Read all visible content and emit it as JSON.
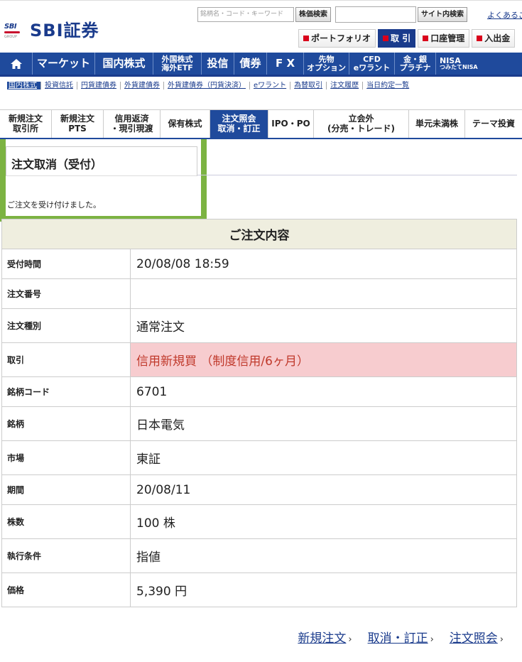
{
  "header": {
    "logo_small": "SBI",
    "logo_group": "GROUP",
    "logo_text": "SBI証券",
    "search_placeholder": "銘柄名・コード・キーワード",
    "stock_search_button": "株価検索",
    "site_search_button": "サイト内検索",
    "faq_link": "よくあるご",
    "topnav": [
      "ポートフォリオ",
      "取 引",
      "口座管理",
      "入出金"
    ]
  },
  "mainnav": {
    "items": [
      "マーケット",
      "国内株式",
      "外国株式",
      "海外ETF",
      "投信",
      "債券",
      "F X",
      "先物",
      "オプション",
      "CFD",
      "eワラント",
      "金・銀",
      "プラチナ",
      "NISA",
      "つみたてNISA"
    ]
  },
  "subnav": {
    "items": [
      "国内株式",
      "投資信託",
      "円貨建債券",
      "外貨建債券",
      "外貨建債券（円貨決済）",
      "eワラント",
      "為替取引",
      "注文履歴",
      "当日約定一覧"
    ]
  },
  "tabs": {
    "t1a": "新規注文",
    "t1b": "取引所",
    "t2a": "新規注文",
    "t2b": "PTS",
    "t3a": "信用返済",
    "t3b": "・現引現渡",
    "t4": "保有株式",
    "t5a": "注文照会",
    "t5b": "取消・訂正",
    "t6": "IPO・PO",
    "t7a": "立会外",
    "t7b": "(分売・トレード)",
    "t8": "単元未満株",
    "t9": "テーマ投資"
  },
  "page": {
    "title": "注文取消（受付）",
    "accepted_message": "ご注文を受け付けました。"
  },
  "order": {
    "heading": "ご注文内容",
    "rows": [
      {
        "label": "受付時間",
        "value": "20/08/08 18:59"
      },
      {
        "label": "注文番号",
        "value": ""
      },
      {
        "label": "注文種別",
        "value": "通常注文"
      },
      {
        "label": "取引",
        "value": "信用新規買 （制度信用/6ヶ月）"
      },
      {
        "label": "銘柄コード",
        "value": "6701"
      },
      {
        "label": "銘柄",
        "value": "日本電気"
      },
      {
        "label": "市場",
        "value": "東証"
      },
      {
        "label": "期間",
        "value": "20/08/11"
      },
      {
        "label": "株数",
        "value": "100 株"
      },
      {
        "label": "執行条件",
        "value": "指値"
      },
      {
        "label": "価格",
        "value": "5,390 円"
      }
    ]
  },
  "footer_links": {
    "new_order": "新規注文",
    "cancel_modify": "取消・訂正",
    "order_inquiry": "注文照会",
    "arrow": "›"
  },
  "colors": {
    "brand_blue": "#1f4a9c",
    "highlight_green": "#7cb342",
    "pink_row": "#f7cccf"
  }
}
